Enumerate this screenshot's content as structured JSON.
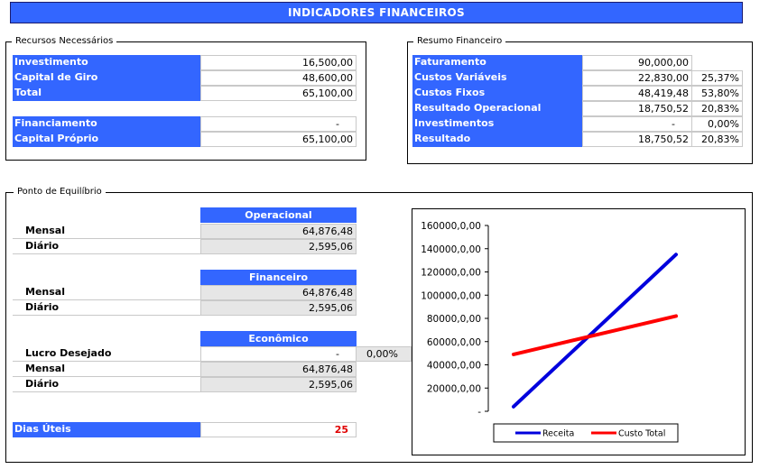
{
  "header": {
    "title": "INDICADORES FINANCEIROS"
  },
  "recursos": {
    "title": "Recursos Necessários",
    "rows": [
      {
        "label": "Investimento",
        "value": "16,500,00"
      },
      {
        "label": "Capital de Giro",
        "value": "48,600,00"
      },
      {
        "label": "Total",
        "value": "65,100,00"
      }
    ],
    "rows2": [
      {
        "label": "Financiamento",
        "value": "-"
      },
      {
        "label": "Capital Próprio",
        "value": "65,100,00"
      }
    ]
  },
  "resumo": {
    "title": "Resumo Financeiro",
    "rows": [
      {
        "label": "Faturamento",
        "value": "90,000,00",
        "pct": ""
      },
      {
        "label": "Custos Variáveis",
        "value": "22,830,00",
        "pct": "25,37%"
      },
      {
        "label": "Custos Fixos",
        "value": "48,419,48",
        "pct": "53,80%"
      },
      {
        "label": "Resultado Operacional",
        "value": "18,750,52",
        "pct": "20,83%"
      },
      {
        "label": "Investimentos",
        "value": "-",
        "pct": "0,00%"
      },
      {
        "label": "Resultado",
        "value": "18,750,52",
        "pct": "20,83%"
      }
    ]
  },
  "equilibrio": {
    "title": "Ponto de Equilíbrio",
    "operacional": {
      "header": "Operacional",
      "mensal_label": "Mensal",
      "mensal": "64,876,48",
      "diario_label": "Diário",
      "diario": "2,595,06"
    },
    "financeiro": {
      "header": "Financeiro",
      "mensal_label": "Mensal",
      "mensal": "64,876,48",
      "diario_label": "Diário",
      "diario": "2,595,06"
    },
    "economico": {
      "header": "Econômico",
      "lucro_label": "Lucro Desejado",
      "lucro": "-",
      "lucro_pct": "0,00%",
      "mensal_label": "Mensal",
      "mensal": "64,876,48",
      "diario_label": "Diário",
      "diario": "2,595,06"
    },
    "dias_uteis_label": "Dias Úteis",
    "dias_uteis": "25"
  },
  "chart_data": {
    "type": "line",
    "title": "",
    "xlabel": "",
    "ylabel": "",
    "ylim": [
      0,
      160000
    ],
    "ytick_labels": [
      "-",
      "20000,0,00",
      "40000,0,00",
      "60000,0,00",
      "80000,0,00",
      "100000,0,00",
      "120000,0,00",
      "140000,0,00",
      "160000,0,00"
    ],
    "x": [
      0,
      1
    ],
    "series": [
      {
        "name": "Receita",
        "color": "#0000dd",
        "values": [
          4000,
          135000
        ]
      },
      {
        "name": "Custo Total",
        "color": "#ff0000",
        "values": [
          49000,
          82000
        ]
      }
    ],
    "grid": false,
    "legend": "bottom"
  }
}
